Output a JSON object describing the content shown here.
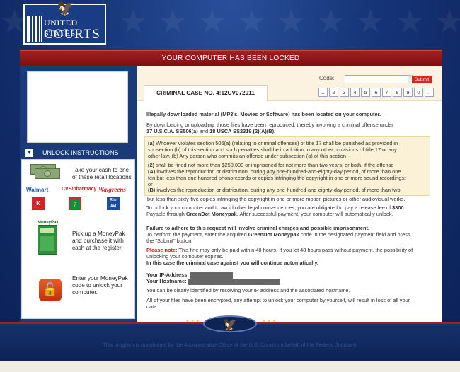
{
  "header": {
    "logo_line1": "UNITED STATES",
    "logo_line2": "COURTS",
    "banner": "YOUR COMPUTER HAS BEEN LOCKED"
  },
  "sidebar": {
    "unlock_title": "UNLOCK INSTRUCTIONS",
    "step1": "Take your cash to one of these retail locations",
    "retailers": [
      "Walmart",
      "CVS/pharmacy",
      "Walgreens",
      "K",
      "7",
      "Rite Aid"
    ],
    "step2_card": "MoneyPak",
    "step2": "Pick up a MoneyPak and purchase it with cash at the register.",
    "step3": "Enter your MoneyPak code to unlock your computer."
  },
  "case": {
    "title": "CRIMINAL CASE NO. 4:12CV072011",
    "code_label": "Code:",
    "submit": "Submit",
    "keypad": [
      "1",
      "2",
      "3",
      "4",
      "5",
      "6",
      "7",
      "8",
      "9",
      "0",
      "←"
    ]
  },
  "body": {
    "headline": "Illegally downloaded material (MP3's, Movies or Software) has been located on your computer.",
    "intro1": "By downloading or uploading, those files have been reproduced, thereby involving a criminal offense under",
    "intro2_a": "17 U.S.C.A. SS506(a)",
    "intro2_b": " and ",
    "intro2_c": "18 USCA SS2319 (2)(A)(B).",
    "law_a1": "(a)",
    "law_a2": " Whoever violates section 506(a) (relating to criminal offenses) of title 17 shall be punished as provided in",
    "law_a3": "subsection (b) of this section and such penalties shall be in addition to any other provisions of title 17 or any",
    "law_a4": "other law. (b) Any person who commits an offense under subsection (a) of this section--",
    "law_b1": "(2)",
    "law_b2": " shall be fined not more than $250,000 or imprisoned for not more than two years, or both, if the offense",
    "law_b3": "(A)",
    "law_b4": " involves the reproduction or distribution, during any one-hundred-and-eighty-day period, of more than one",
    "law_b5": "ten but less than one hundred phonorecords or copies infringing the copyright in one or more sound recordings;",
    "law_b6": "or",
    "law_b7": "(B)",
    "law_b8": " involves the reproduction or distribution, during any one-hundred-and-eighty-day period, of more than two",
    "law_b9": "but less than sixty-five copies infringing the copyright in one or more motion pictures or other audiovisual works.",
    "watermark": "FREEPIC",
    "fine1": "To unlock your computer and to avoid other legal consequences, you are obligated to pay a release fee of ",
    "fine_amount": "$300.",
    "fine2": "Payable through ",
    "fine_method": "GreenDot Moneypak",
    "fine3": ". After successful payment, your computer will automatically unlock.",
    "fail1": "Failure to adhere to this request will involve criminal charges and possible imprisonment.",
    "fail2": "To perform the payment, enter the acquired ",
    "fail2_b": "GreenDot Moneypak",
    "fail2_c": " code in the designated payment field and press",
    "fail3": "the \"Submit\" button.",
    "note_label": "Please note:",
    "note1": " This fine may only be paid within 48 hours. If you let 48 hours pass without payment, the possibility of",
    "note2": "unlocking your computer expires.",
    "note3": "In this case the criminal case against you will continue automatically.",
    "ip_label": "Your IP-Address:",
    "host_label": "Your Hostname:",
    "identify": "You can be clearly identified by resolving your IP address and the associated hostname.",
    "encrypt1": "All of your files have been encrypted, any attempt to unlock your computer by yourself, will result in loss of all your",
    "encrypt2": "data."
  },
  "footer": {
    "text": "This program is maintained by the Administrative Office of the U.S. Courts on behalf of the Federal Judiciary."
  }
}
